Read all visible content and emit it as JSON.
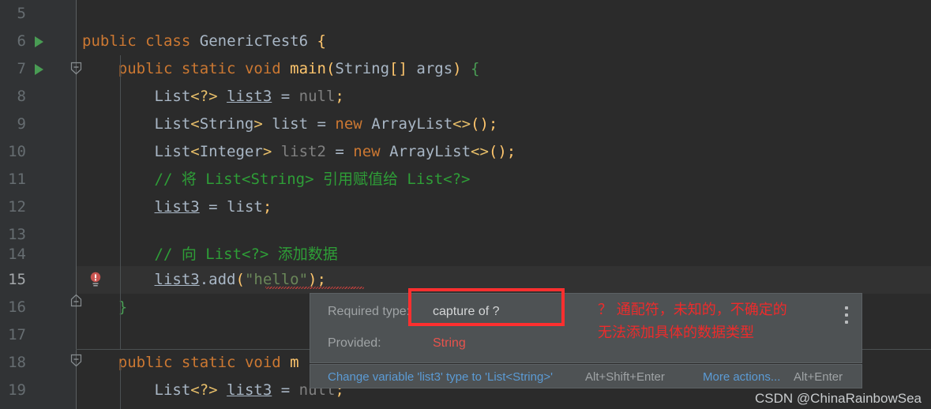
{
  "editor": {
    "theme_background": "#2b2b2b",
    "gutter_background": "#313335",
    "current_line_background": "#323232",
    "first_line_number": 5,
    "lines": [
      {
        "n": "5",
        "text": ""
      },
      {
        "n": "6",
        "text": "public class GenericTest6 {"
      },
      {
        "n": "7",
        "text": "    public static void main(String[] args) {"
      },
      {
        "n": "8",
        "text": "        List<?> list3 = null;"
      },
      {
        "n": "9",
        "text": "        List<String> list = new ArrayList<>();"
      },
      {
        "n": "10",
        "text": "        List<Integer> list2 = new ArrayList<>();"
      },
      {
        "n": "11",
        "text": "        // 将 List<String> 引用赋值给 List<?>"
      },
      {
        "n": "12",
        "text": "        list3 = list;"
      },
      {
        "n": "13",
        "text": ""
      },
      {
        "n": "14",
        "text": "        // 向 List<?> 添加数据"
      },
      {
        "n": "15",
        "text": "        list3.add(\"hello\");"
      },
      {
        "n": "16",
        "text": "    }"
      },
      {
        "n": "17",
        "text": ""
      },
      {
        "n": "18",
        "text": "    public static void m"
      },
      {
        "n": "19",
        "text": "        List<?> list3 = null;"
      }
    ],
    "run_markers": [
      "6",
      "7"
    ],
    "error_line": "15",
    "error_icon": "red-lightbulb-icon"
  },
  "tooltip": {
    "rows": [
      {
        "label": "Required type:",
        "value": "capture of ?",
        "error": false
      },
      {
        "label": "Provided:",
        "value": "String",
        "error": true
      }
    ],
    "menu_icon": "kebab-menu-icon",
    "actions": [
      {
        "label": "Change variable 'list3' type to 'List<String>'",
        "shortcut": "Alt+Shift+Enter"
      },
      {
        "label": "More actions...",
        "shortcut": "Alt+Enter"
      }
    ],
    "link_color": "#5b9bd5",
    "background": "#4e5254"
  },
  "annotation": {
    "box_color": "#fd2f2f",
    "text_color": "#ee2b2b",
    "line1": "？ 通配符，未知的，不确定的",
    "line2": "无法添加具体的数据类型"
  },
  "watermark": {
    "text": "CSDN @ChinaRainbowSea"
  }
}
